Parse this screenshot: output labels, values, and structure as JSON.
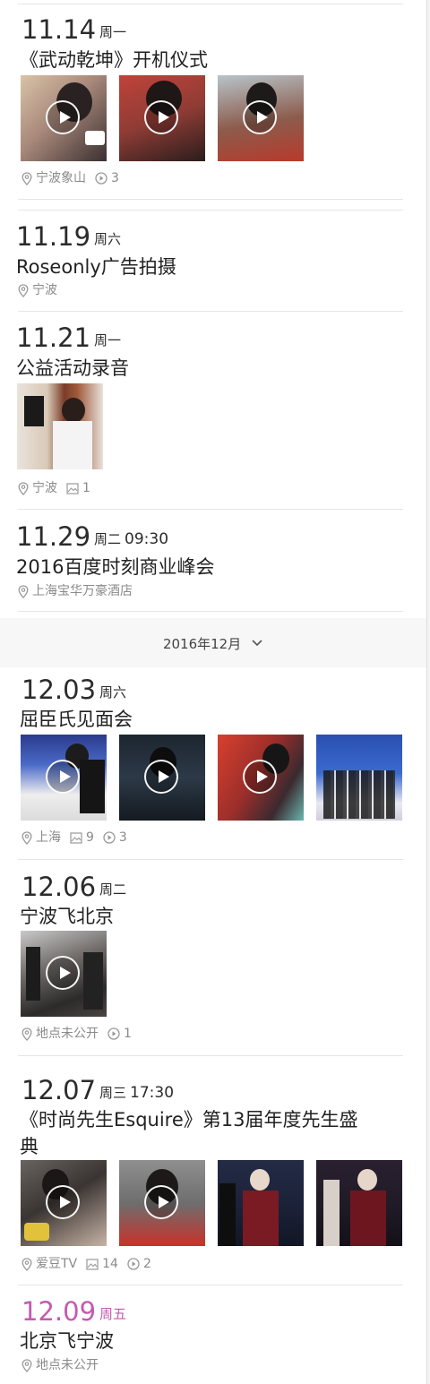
{
  "events": [
    {
      "date": "11.14",
      "weekday": "周一",
      "time": "",
      "title": "《武动乾坤》开机仪式",
      "location": "宁波象山",
      "videos": "3"
    },
    {
      "date": "11.19",
      "weekday": "周六",
      "time": "",
      "title": "Roseonly广告拍摄",
      "location": "宁波"
    },
    {
      "date": "11.21",
      "weekday": "周一",
      "time": "",
      "title": "公益活动录音",
      "location": "宁波",
      "images": "1"
    },
    {
      "date": "11.29",
      "weekday": "周二",
      "time": "09:30",
      "title": "2016百度时刻商业峰会",
      "location": "上海宝华万豪酒店"
    },
    {
      "date": "12.03",
      "weekday": "周六",
      "time": "",
      "title": "屈臣氏见面会",
      "location": "上海",
      "images": "9",
      "videos": "3"
    },
    {
      "date": "12.06",
      "weekday": "周二",
      "time": "",
      "title": "宁波飞北京",
      "location": "地点未公开",
      "videos": "1"
    },
    {
      "date": "12.07",
      "weekday": "周三",
      "time": "17:30",
      "title_line1": "《时尚先生Esquire》第13届年度先生盛",
      "title_line2": "典",
      "location": "爱豆TV",
      "images": "14",
      "videos": "2"
    },
    {
      "date": "12.09",
      "weekday": "周五",
      "time": "",
      "title": "北京飞宁波",
      "location": "地点未公开"
    }
  ],
  "month_divider": {
    "label": "2016年12月"
  },
  "colors": {
    "highlight": "#c45ab0",
    "text": "#222222",
    "meta": "#8a8a8a"
  }
}
